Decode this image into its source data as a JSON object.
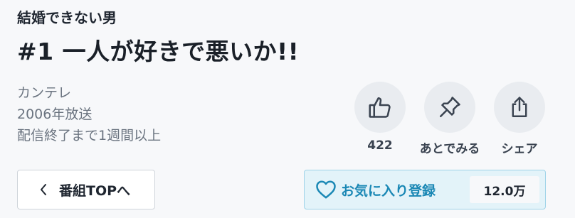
{
  "series": {
    "title": "結婚できない男"
  },
  "episode": {
    "title": "#1 一人が好きで悪いか!!"
  },
  "meta": {
    "broadcaster": "カンテレ",
    "aired": "2006年放送",
    "availability": "配信終了まで1週間以上"
  },
  "actions": {
    "like": {
      "label": "422",
      "icon": "thumbs-up-icon"
    },
    "watch_later": {
      "label": "あとでみる",
      "icon": "pin-icon"
    },
    "share": {
      "label": "シェア",
      "icon": "share-icon"
    }
  },
  "nav": {
    "back_label": "番組TOPへ",
    "icon": "chevron-left-icon"
  },
  "favorite": {
    "label": "お気に入り登録",
    "count": "12.0万",
    "icon": "heart-icon",
    "accent": "#1b88b5"
  }
}
